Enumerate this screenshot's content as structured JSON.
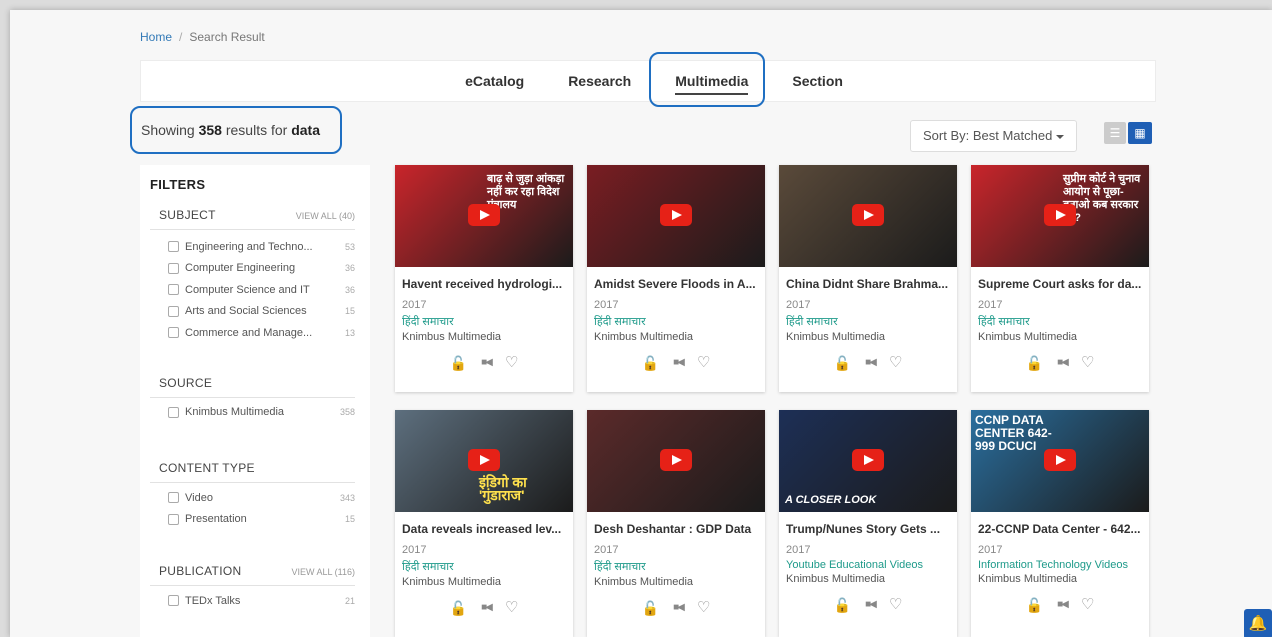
{
  "breadcrumb": {
    "home": "Home",
    "sep": "/",
    "current": "Search Result"
  },
  "tabs": [
    {
      "label": "eCatalog",
      "active": false
    },
    {
      "label": "Research",
      "active": false
    },
    {
      "label": "Multimedia",
      "active": true
    },
    {
      "label": "Section",
      "active": false
    }
  ],
  "results": {
    "prefix": "Showing",
    "count": "358",
    "middle": "results for",
    "query": "data"
  },
  "sort": {
    "label": "Sort By: Best Matched"
  },
  "filters": {
    "title": "FILTERS",
    "subject": {
      "title": "SUBJECT",
      "view_all": "VIEW ALL (40)",
      "items": [
        {
          "label": "Engineering and Techno...",
          "count": "53"
        },
        {
          "label": "Computer Engineering",
          "count": "36"
        },
        {
          "label": "Computer Science and IT",
          "count": "36"
        },
        {
          "label": "Arts and Social Sciences",
          "count": "15"
        },
        {
          "label": "Commerce and Manage...",
          "count": "13"
        }
      ]
    },
    "source": {
      "title": "SOURCE",
      "items": [
        {
          "label": "Knimbus Multimedia",
          "count": "358"
        }
      ]
    },
    "content_type": {
      "title": "CONTENT TYPE",
      "items": [
        {
          "label": "Video",
          "count": "343"
        },
        {
          "label": "Presentation",
          "count": "15"
        }
      ]
    },
    "publication": {
      "title": "PUBLICATION",
      "view_all": "VIEW ALL (116)",
      "items": [
        {
          "label": "TEDx Talks",
          "count": "21"
        }
      ]
    }
  },
  "cards": [
    {
      "title": "Havent received hydrologi...",
      "year": "2017",
      "publisher": "हिंदी समाचार",
      "source": "Knimbus Multimedia",
      "thumb_text": "बाढ़ से जुड़ा आंकड़ा नहीं कर रहा विदेश मंत्रालय",
      "thumb_color": "#c9252b"
    },
    {
      "title": "Amidst Severe Floods in A...",
      "year": "2017",
      "publisher": "हिंदी समाचार",
      "source": "Knimbus Multimedia",
      "thumb_text": "",
      "thumb_color": "#7a1d22"
    },
    {
      "title": "China Didnt Share Brahma...",
      "year": "2017",
      "publisher": "हिंदी समाचार",
      "source": "Knimbus Multimedia",
      "thumb_text": "",
      "thumb_color": "#5a4a3a"
    },
    {
      "title": "Supreme Court asks for da...",
      "year": "2017",
      "publisher": "हिंदी समाचार",
      "source": "Knimbus Multimedia",
      "thumb_text": "सुप्रीम कोर्ट ने चुनाव आयोग से पूछा- बताओ कब सरकार को?",
      "thumb_color": "#c9252b"
    },
    {
      "title": "Data reveals increased lev...",
      "year": "2017",
      "publisher": "हिंदी समाचार",
      "source": "Knimbus Multimedia",
      "thumb_text": "इंडिगो का 'गुंडाराज'",
      "thumb_color": "#5d6f7e"
    },
    {
      "title": "Desh Deshantar : GDP Data",
      "year": "2017",
      "publisher": "हिंदी समाचार",
      "source": "Knimbus Multimedia",
      "thumb_text": "",
      "thumb_color": "#5b2a2a"
    },
    {
      "title": "Trump/Nunes Story Gets ...",
      "year": "2017",
      "publisher": "Youtube Educational Videos",
      "source": "Knimbus Multimedia",
      "thumb_text": "A CLOSER LOOK",
      "thumb_color": "#1d2f56"
    },
    {
      "title": "22-CCNP Data Center - 642...",
      "year": "2017",
      "publisher": "Information Technology Videos",
      "source": "Knimbus Multimedia",
      "thumb_text": "CCNP DATA CENTER 642-999 DCUCI",
      "thumb_color": "#2a6f9f"
    }
  ]
}
